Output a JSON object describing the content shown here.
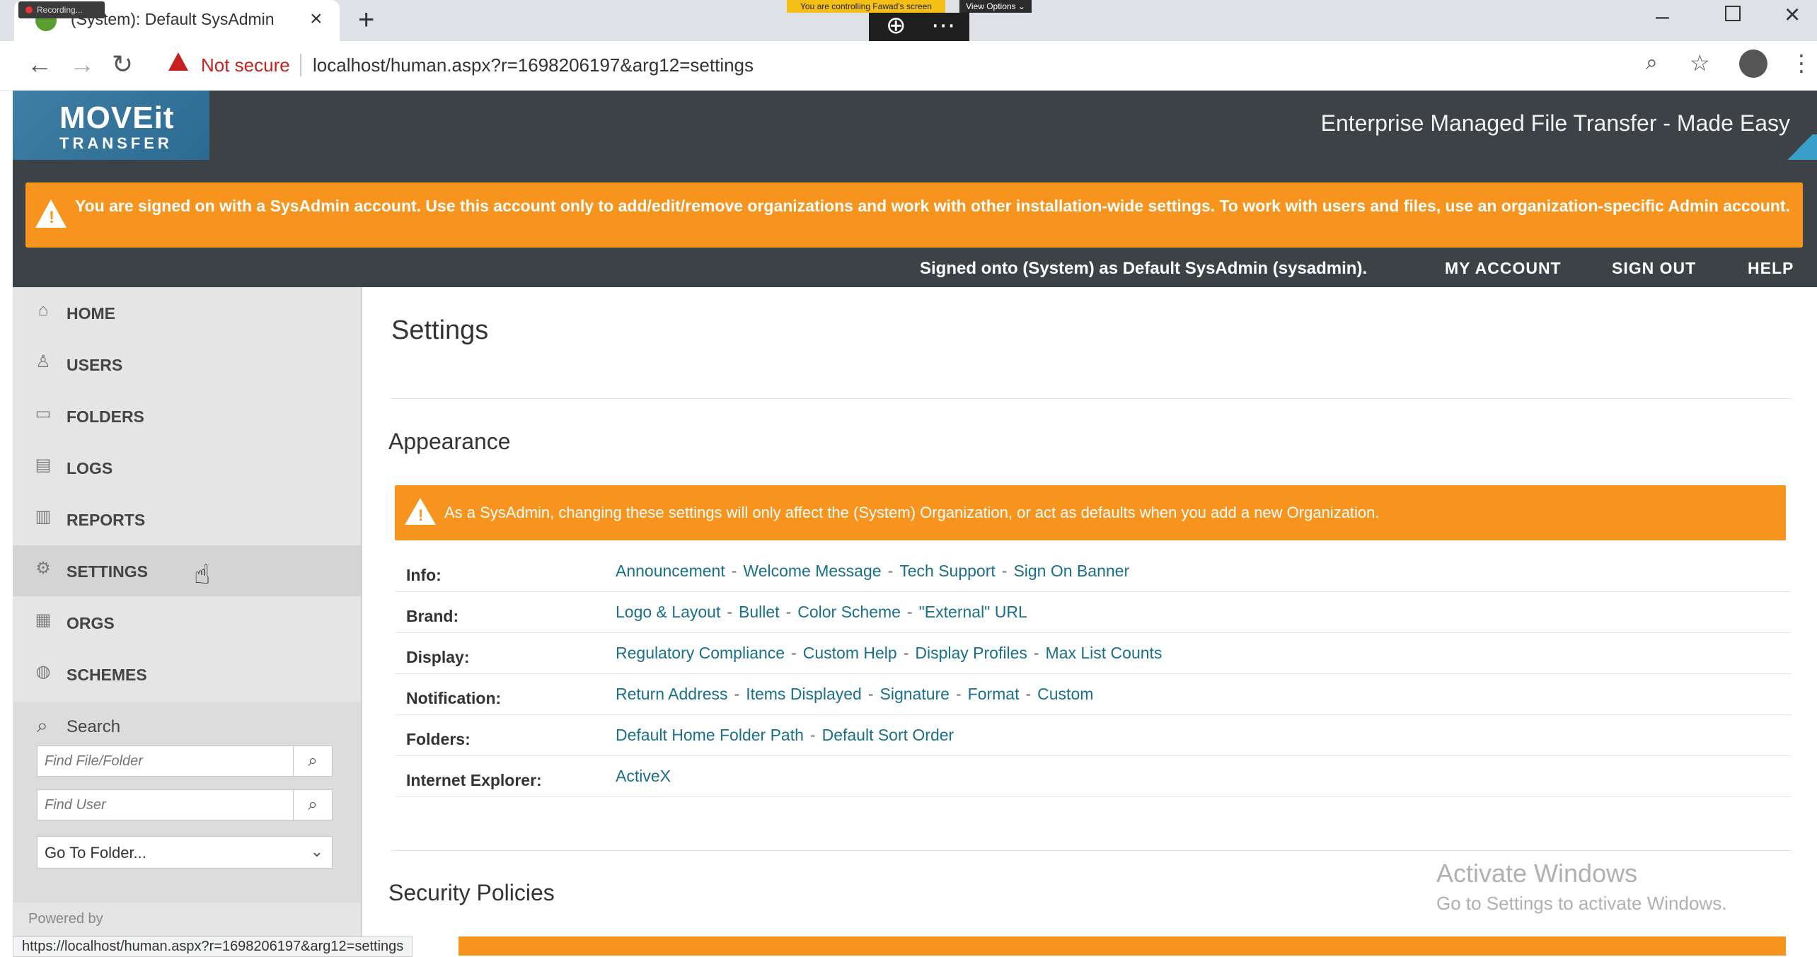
{
  "browser": {
    "tab_title": "(System): Default SysAdmin",
    "recording_label": "Recording...",
    "control_banner": "You are controlling Fawad's screen",
    "view_options": "View Options ⌄",
    "not_secure": "Not secure",
    "url": "localhost/human.aspx?r=1698206197&arg12=settings",
    "status_url": "https://localhost/human.aspx?r=1698206197&arg12=settings"
  },
  "header": {
    "logo_top": "MOVEit",
    "logo_bottom": "TRANSFER",
    "tagline": "Enterprise Managed File Transfer - Made Easy"
  },
  "alert": {
    "message": "You are signed on with a SysAdmin account. Use this account only to add/edit/remove organizations and work with other installation-wide settings. To work with users and files, use an organization-specific Admin account."
  },
  "userbar": {
    "signed_on": "Signed onto (System) as Default SysAdmin (sysadmin).",
    "my_account": "MY ACCOUNT",
    "sign_out": "SIGN OUT",
    "help": "HELP"
  },
  "sidebar": {
    "items": [
      {
        "label": "HOME",
        "icon": "home-icon"
      },
      {
        "label": "USERS",
        "icon": "user-icon"
      },
      {
        "label": "FOLDERS",
        "icon": "folder-icon"
      },
      {
        "label": "LOGS",
        "icon": "log-icon"
      },
      {
        "label": "REPORTS",
        "icon": "chart-icon"
      },
      {
        "label": "SETTINGS",
        "icon": "gear-icon",
        "active": true
      },
      {
        "label": "ORGS",
        "icon": "building-icon"
      },
      {
        "label": "SCHEMES",
        "icon": "scheme-icon"
      }
    ],
    "search": {
      "title": "Search",
      "file_placeholder": "Find File/Folder",
      "user_placeholder": "Find User",
      "goto_folder": "Go To Folder..."
    },
    "powered_by": "Powered by"
  },
  "main": {
    "page_title": "Settings",
    "appearance": {
      "title": "Appearance",
      "alert": "As a SysAdmin, changing these settings will only affect the (System) Organization, or act as defaults when you add a new Organization.",
      "rows": [
        {
          "label": "Info:",
          "links": [
            "Announcement",
            "Welcome Message",
            "Tech Support",
            "Sign On Banner"
          ]
        },
        {
          "label": "Brand:",
          "links": [
            "Logo & Layout",
            "Bullet",
            "Color Scheme",
            "\"External\" URL"
          ]
        },
        {
          "label": "Display:",
          "links": [
            "Regulatory Compliance",
            "Custom Help",
            "Display Profiles",
            "Max List Counts"
          ]
        },
        {
          "label": "Notification:",
          "links": [
            "Return Address",
            "Items Displayed",
            "Signature",
            "Format",
            "Custom"
          ]
        },
        {
          "label": "Folders:",
          "links": [
            "Default Home Folder Path",
            "Default Sort Order"
          ]
        },
        {
          "label": "Internet Explorer:",
          "links": [
            "ActiveX"
          ]
        }
      ]
    },
    "security_title": "Security Policies"
  },
  "watermark": {
    "line1": "Activate Windows",
    "line2": "Go to Settings to activate Windows."
  },
  "colors": {
    "header_bg": "#3d4246",
    "alert_orange": "#f7941d",
    "link_teal": "#1a6f8b",
    "sidebar_bg": "#e5e5e5"
  }
}
